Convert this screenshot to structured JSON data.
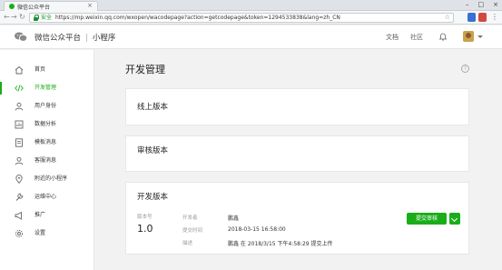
{
  "browser": {
    "tab_title": "微信公众平台",
    "tab_close": "×",
    "secure_label": "安全",
    "url": "https://mp.weixin.qq.com/wxopen/wacodepage?action=getcodepage&token=1294533838&lang=zh_CN",
    "window_controls": [
      "–",
      "□",
      "×"
    ]
  },
  "header": {
    "platform_name": "微信公众平台",
    "separator": "|",
    "product_name": "小程序",
    "links": [
      "文档",
      "社区"
    ]
  },
  "sidebar": {
    "items": [
      {
        "label": "首页",
        "icon": "home-icon",
        "active": false
      },
      {
        "label": "开发管理",
        "icon": "code-icon",
        "active": true
      },
      {
        "label": "用户身份",
        "icon": "user-icon",
        "active": false
      },
      {
        "label": "数据分析",
        "icon": "chart-icon",
        "active": false
      },
      {
        "label": "模板消息",
        "icon": "template-icon",
        "active": false
      },
      {
        "label": "客服消息",
        "icon": "service-icon",
        "active": false
      },
      {
        "label": "附近的小程序",
        "icon": "location-icon",
        "active": false
      },
      {
        "label": "运维中心",
        "icon": "wrench-icon",
        "active": false
      },
      {
        "label": "推广",
        "icon": "megaphone-icon",
        "active": false
      },
      {
        "label": "设置",
        "icon": "gear-icon",
        "active": false
      }
    ]
  },
  "main": {
    "title": "开发管理",
    "help": "?",
    "cards": {
      "online": {
        "title": "线上版本"
      },
      "review": {
        "title": "审核版本"
      },
      "dev": {
        "title": "开发版本",
        "version_label": "版本号",
        "version": "1.0",
        "developer_label": "开发者",
        "developer": "鹏鑫",
        "submit_time_label": "提交时间",
        "submit_time": "2018-03-15 16:58:00",
        "desc_label": "描述",
        "desc": "鹏鑫 在 2018/3/15 下午4:58:29 提交上传",
        "submit_button": "提交审核"
      }
    }
  },
  "colors": {
    "accent": "#1aad19",
    "header_bg": "#ffffff",
    "page_bg": "#f2f2f2"
  }
}
